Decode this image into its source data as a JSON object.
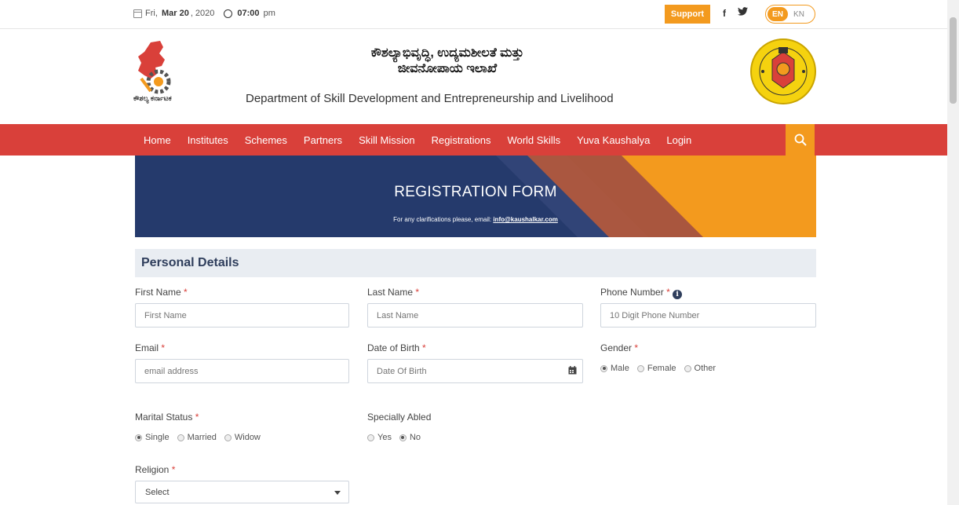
{
  "topbar": {
    "date_prefix": "Fri,",
    "date_bold": "Mar 20",
    "date_year": ", 2020",
    "time_bold": "07:00",
    "time_suffix": "pm",
    "support_label": "Support",
    "facebook": "f",
    "twitter": "🐦",
    "lang_en": "EN",
    "lang_kn": "KN"
  },
  "header": {
    "kannada_line1": "ಕೌಶಲ್ಯಾಭಿವೃದ್ಧಿ, ಉದ್ಯಮಶೀಲತೆ ಮತ್ತು",
    "kannada_line2": "ಜೀವನೋಪಾಯ ಇಲಾಖೆ",
    "department": "Department of Skill Development and Entrepreneurship and Livelihood",
    "logo_text": "ಕೌಶಲ್ಯ ಕರ್ನಾಟಕ"
  },
  "nav": {
    "items": [
      "Home",
      "Institutes",
      "Schemes",
      "Partners",
      "Skill Mission",
      "Registrations",
      "World Skills",
      "Yuva Kaushalya",
      "Login"
    ],
    "search_icon": "search-icon"
  },
  "banner": {
    "title": "REGISTRATION FORM",
    "sub_text": "For any clarifications please, email: ",
    "email": "info@kaushalkar.com"
  },
  "form": {
    "section_title": "Personal Details",
    "first_name": {
      "label": "First Name",
      "placeholder": "First Name"
    },
    "last_name": {
      "label": "Last Name",
      "placeholder": "Last Name"
    },
    "phone": {
      "label": "Phone Number",
      "placeholder": "10 Digit Phone Number"
    },
    "email": {
      "label": "Email",
      "placeholder": "email address"
    },
    "dob": {
      "label": "Date of Birth",
      "placeholder": "Date Of Birth"
    },
    "gender": {
      "label": "Gender",
      "options": [
        "Male",
        "Female",
        "Other"
      ],
      "selected": "Male"
    },
    "marital": {
      "label": "Marital Status",
      "options": [
        "Single",
        "Married",
        "Widow"
      ],
      "selected": "Single"
    },
    "specially_abled": {
      "label": "Specially Abled",
      "options": [
        "Yes",
        "No"
      ],
      "selected": "No"
    },
    "religion": {
      "label": "Religion",
      "value": "Select"
    },
    "required_mark": "*"
  },
  "colors": {
    "nav_red": "#d9403a",
    "accent_orange": "#f39a1e",
    "banner_blue": "#253a6c"
  }
}
